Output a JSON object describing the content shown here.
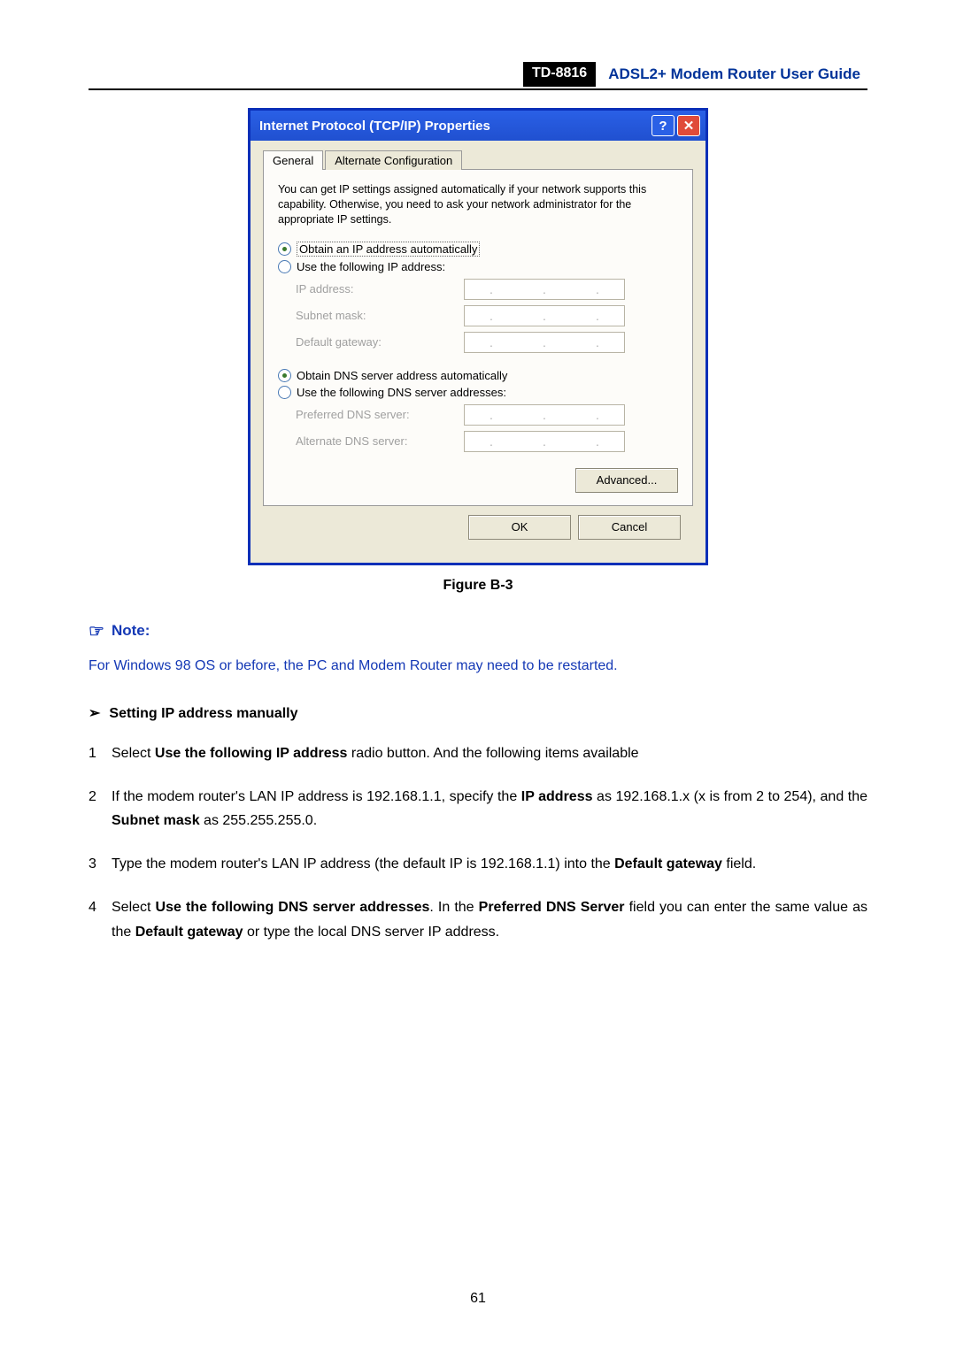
{
  "header": {
    "model": "TD-8816",
    "guide": "ADSL2+  Modem  Router  User  Guide"
  },
  "dialog": {
    "title": "Internet Protocol (TCP/IP) Properties",
    "help_symbol": "?",
    "close_symbol": "✕",
    "tabs": {
      "general": "General",
      "alt": "Alternate Configuration"
    },
    "description": "You can get IP settings assigned automatically if your network supports this capability. Otherwise, you need to ask your network administrator for the appropriate IP settings.",
    "radio_ip_auto": "Obtain an IP address automatically",
    "radio_ip_manual": "Use the following IP address:",
    "labels": {
      "ip": "IP address:",
      "subnet": "Subnet mask:",
      "gateway": "Default gateway:",
      "pref_dns": "Preferred DNS server:",
      "alt_dns": "Alternate DNS server:"
    },
    "radio_dns_auto": "Obtain DNS server address automatically",
    "radio_dns_manual": "Use the following DNS server addresses:",
    "buttons": {
      "advanced": "Advanced...",
      "ok": "OK",
      "cancel": "Cancel"
    }
  },
  "figure_caption": "Figure B-3",
  "note": {
    "icon": "☞",
    "heading": "Note:",
    "text": "For Windows 98 OS or before, the PC and Modem Router may need to be restarted."
  },
  "section": {
    "arrow": "➢",
    "title": "Setting IP address manually"
  },
  "steps": {
    "s1_a": "Select ",
    "s1_b": "Use the following IP address",
    "s1_c": " radio button. And the following items available",
    "s2_a": "If the modem router's LAN IP address is 192.168.1.1, specify the ",
    "s2_b": "IP address",
    "s2_c": " as 192.168.1.x (x is from 2 to 254), and the ",
    "s2_d": "Subnet mask",
    "s2_e": " as 255.255.255.0.",
    "s3_a": "Type the modem router's LAN IP address (the default IP is 192.168.1.1) into the ",
    "s3_b": "Default gateway",
    "s3_c": " field.",
    "s4_a": "Select ",
    "s4_b": "Use the following DNS server addresses",
    "s4_c": ". In the ",
    "s4_d": "Preferred DNS Server",
    "s4_e": " field you can enter the same value as the ",
    "s4_f": "Default gateway",
    "s4_g": " or type the local DNS server IP address."
  },
  "page_number": "61"
}
